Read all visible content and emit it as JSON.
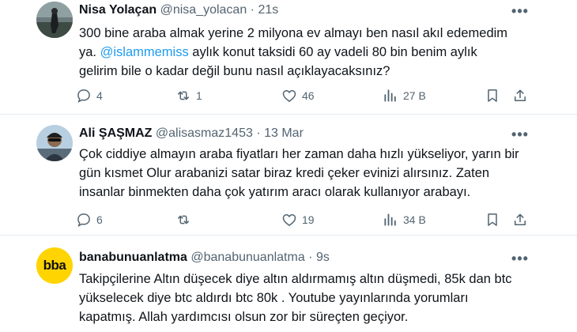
{
  "tweets": [
    {
      "name": "Nisa Yolaçan",
      "handle": "@nisa_yolacan",
      "sep": "·",
      "time": "21s",
      "more": "•••",
      "lines": [
        {
          "text": "300 bine araba almak yerine 2 milyona ev almayı ben nasıl akıl edemedim"
        },
        {
          "text_before": "ya. ",
          "mention": "@islammemiss",
          "text_after": " aylık konut taksidi 60 ay vadeli 80 bin benim aylık"
        },
        {
          "text": "gelirim bile o kadar değil bunu nasıl açıklayacaksınız?"
        }
      ],
      "replies": "4",
      "retweets": "1",
      "likes": "46",
      "views": "27 B"
    },
    {
      "name": "Ali ŞAŞMAZ",
      "handle": "@alisasmaz1453",
      "sep": "·",
      "time": "13 Mar",
      "more": "•••",
      "lines": [
        {
          "text": "Çok ciddiye almayın araba fiyatları her zaman daha hızlı yükseliyor, yarın bir"
        },
        {
          "text": "gün kısmet Olur arabanizi satar biraz kredi çeker evinizi alırsınız. Zaten"
        },
        {
          "text": "insanlar binmekten daha çok yatırım aracı olarak kullanıyor arabayı."
        }
      ],
      "replies": "6",
      "retweets": "",
      "likes": "19",
      "views": "34 B"
    },
    {
      "name": "banabunuanlatma",
      "handle": "@banabunuanlatma",
      "sep": "·",
      "time": "9s",
      "more": "•••",
      "avatar_text": "bba",
      "lines": [
        {
          "text": "Takipçilerine Altın düşecek diye altın aldırmamış altın düşmedi, 85k dan btc"
        },
        {
          "text": "yükselecek diye btc aldırdı btc 80k . Youtube yayınlarında yorumları"
        },
        {
          "text": "kapatmış. Allah yardımcısı olsun zor bir süreçten geçiyor."
        }
      ]
    }
  ],
  "colors": {
    "text": "#0f1419",
    "secondary": "#536471",
    "mention": "#1d9bf0",
    "divider": "#e6ecf0",
    "bba_bg": "#ffd400"
  },
  "icons": [
    "reply-icon",
    "retweet-icon",
    "like-icon",
    "views-icon",
    "bookmark-icon",
    "share-icon",
    "more-icon"
  ]
}
